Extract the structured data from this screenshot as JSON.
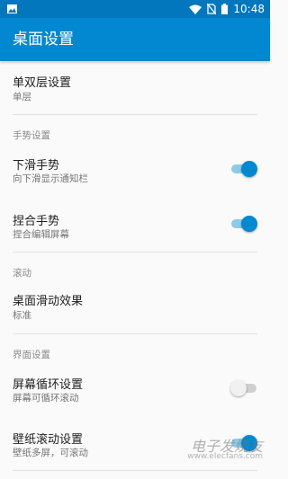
{
  "status_bar": {
    "time": "10:48",
    "icons": [
      "image-icon",
      "wifi-icon",
      "no-sim-icon",
      "battery-icon"
    ]
  },
  "app_bar": {
    "title": "桌面设置"
  },
  "items": [
    {
      "title": "单双层设置",
      "summary": "单层"
    },
    {
      "header": "手势设置"
    },
    {
      "title": "下滑手势",
      "summary": "向下滑显示通知栏",
      "switch": true
    },
    {
      "title": "捏合手势",
      "summary": "捏合编辑屏幕",
      "switch": true
    },
    {
      "header": "滚动"
    },
    {
      "title": "桌面滑动效果",
      "summary": "标准"
    },
    {
      "header": "界面设置"
    },
    {
      "title": "屏幕循环设置",
      "summary": "屏幕可循环滚动",
      "switch": false
    },
    {
      "title": "壁纸滚动设置",
      "summary": "壁纸多屏，可滚动",
      "switch": true
    }
  ],
  "watermark": {
    "text": "电子发烧友",
    "sub": "www.elecfans.com"
  },
  "colors": {
    "status_bar": "#0277bd",
    "app_bar": "#0288d1",
    "accent": "#0288d1",
    "switch_track_on": "#8ecae6"
  }
}
